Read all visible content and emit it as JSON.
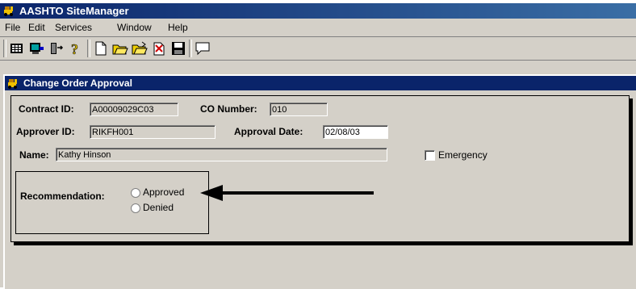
{
  "app": {
    "title": "AASHTO SiteManager"
  },
  "menu": {
    "file": "File",
    "edit": "Edit",
    "services": "Services",
    "window": "Window",
    "help": "Help"
  },
  "toolbar": {
    "buttons": [
      "grid-icon",
      "monitor-icon",
      "door-exit-icon",
      "help-icon",
      "new-document-icon",
      "open-folder-icon",
      "open-folder-alt-icon",
      "clear-icon",
      "save-icon",
      "message-icon"
    ]
  },
  "window": {
    "title": "Change Order Approval"
  },
  "form": {
    "contract_id_label": "Contract ID:",
    "contract_id_value": "A00009029C03",
    "co_number_label": "CO Number:",
    "co_number_value": "010",
    "approver_id_label": "Approver ID:",
    "approver_id_value": "RIKFH001",
    "approval_date_label": "Approval Date:",
    "approval_date_value": "02/08/03",
    "name_label": "Name:",
    "name_value": "Kathy Hinson",
    "emergency_label": "Emergency",
    "emergency_checked": false,
    "recommendation_label": "Recommendation:",
    "approved_label": "Approved",
    "denied_label": "Denied",
    "recommendation_selected": ""
  },
  "colors": {
    "titlebar": "#0a246a",
    "window_bg": "#d4d0c8"
  }
}
